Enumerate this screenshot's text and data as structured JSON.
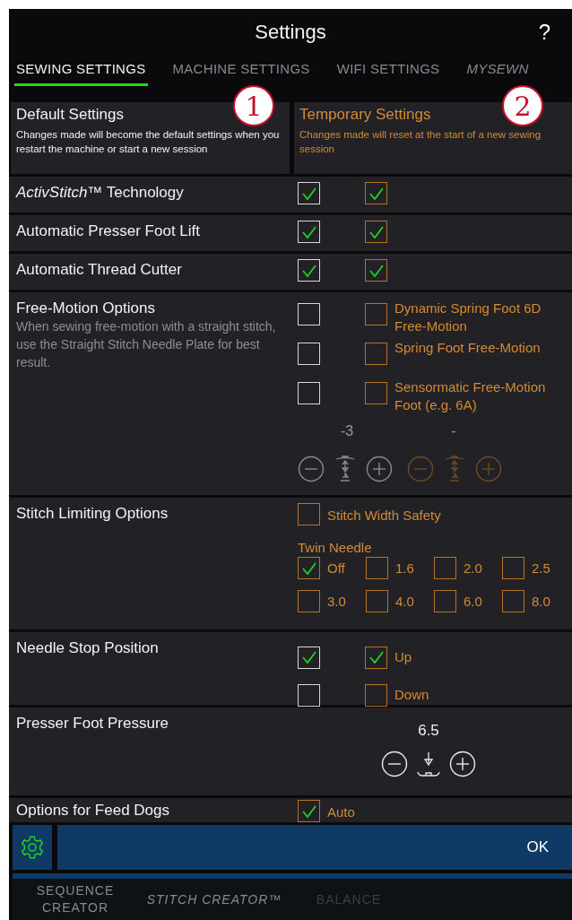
{
  "header": {
    "title": "Settings",
    "help": "?"
  },
  "tabs": [
    {
      "label": "SEWING SETTINGS",
      "selected": true
    },
    {
      "label": "MACHINE SETTINGS",
      "selected": false
    },
    {
      "label": "WIFI SETTINGS",
      "selected": false
    },
    {
      "label": "MYSEWN",
      "selected": false
    }
  ],
  "callouts": [
    "1",
    "2"
  ],
  "columns": [
    {
      "title": "Default Settings",
      "description": "Changes made will become the default settings when you restart the machine or start a new session"
    },
    {
      "title": "Temporary Settings",
      "description": "Changes made will reset at the start of a new sewing session"
    }
  ],
  "rows": [
    {
      "kind": "check",
      "label": "*ActivStitch*™ Technology",
      "default_checked": true,
      "temp_checked": true
    },
    {
      "kind": "check",
      "label": "Automatic Presser Foot Lift",
      "default_checked": true,
      "temp_checked": true
    },
    {
      "kind": "check",
      "label": "Automatic Thread Cutter",
      "default_checked": true,
      "temp_checked": true
    },
    {
      "kind": "free_motion",
      "label": "Free-Motion Options",
      "description": "When sewing free-motion with a straight stitch, use the Straight Stitch Needle Plate for best result.",
      "options": [
        {
          "label": "Dynamic Spring Foot 6D Free-Motion",
          "default_checked": false,
          "temp_checked": false
        },
        {
          "label": "Spring Foot Free-Motion",
          "default_checked": false,
          "temp_checked": false
        },
        {
          "label": "Sensormatic Free-Motion Foot (e.g. 6A)",
          "default_checked": false,
          "temp_checked": false
        }
      ],
      "default_value": "-3",
      "temp_value": "-"
    },
    {
      "kind": "stitch_limit",
      "label": "Stitch Limiting Options",
      "options": [
        {
          "label": "Stitch Width Safety",
          "checked": false
        }
      ],
      "twin_label": "Twin Needle",
      "twin_options": [
        {
          "label": "Off",
          "checked": true
        },
        {
          "label": "1.6",
          "checked": false
        },
        {
          "label": "2.0",
          "checked": false
        },
        {
          "label": "2.5",
          "checked": false
        },
        {
          "label": "3.0",
          "checked": false
        },
        {
          "label": "4.0",
          "checked": false
        },
        {
          "label": "6.0",
          "checked": false
        },
        {
          "label": "8.0",
          "checked": false
        }
      ]
    },
    {
      "kind": "needle_stop",
      "label": "Needle Stop Position",
      "options": [
        {
          "label": "Up",
          "default_checked": true,
          "temp_checked": true
        },
        {
          "label": "Down",
          "default_checked": false,
          "temp_checked": false
        }
      ]
    },
    {
      "kind": "pressure",
      "label": "Presser Foot Pressure",
      "value": "6.5"
    },
    {
      "kind": "feed_dogs",
      "label": "Options for Feed Dogs",
      "options": [
        {
          "label": "Auto",
          "checked": true
        }
      ]
    }
  ],
  "action_bar": {
    "ok": "OK"
  },
  "bottom_tabs": [
    {
      "label": "SEQUENCE CREATOR",
      "disabled": false
    },
    {
      "label": "STITCH CREATOR™",
      "disabled": false
    },
    {
      "label": "BALANCE",
      "disabled": true
    }
  ]
}
